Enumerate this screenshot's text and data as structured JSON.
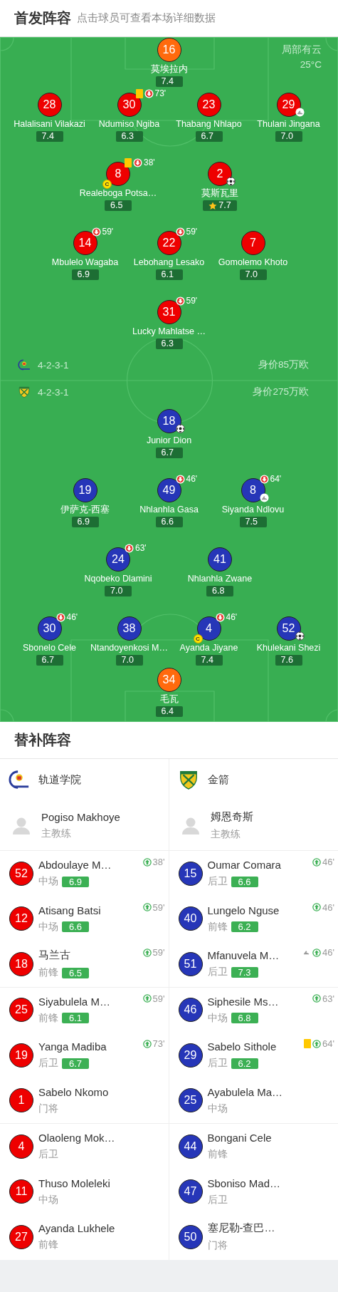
{
  "lineup_header": {
    "title": "首发阵容",
    "hint": "点击球员可查看本场详细数据"
  },
  "pitch": {
    "weather": {
      "condition": "局部有云",
      "temperature": "25°C"
    },
    "home_lines": [
      [
        {
          "number": "16",
          "name": "莫埃拉内",
          "rating": "7.4",
          "color": "#ff6a0d"
        }
      ],
      [
        {
          "number": "28",
          "name": "Halalisani Vilakazi",
          "rating": "7.4",
          "color": "#ee0000"
        },
        {
          "number": "30",
          "name": "Ndumiso Ngiba",
          "rating": "6.3",
          "color": "#ee0000",
          "events": [
            {
              "kind": "yellow"
            },
            {
              "kind": "off",
              "minute": "73'"
            }
          ]
        },
        {
          "number": "23",
          "name": "Thabang Nhlapo",
          "rating": "6.7",
          "color": "#ee0000"
        },
        {
          "number": "29",
          "name": "Thulani Jingana",
          "rating": "7.0",
          "color": "#ee0000",
          "events": [
            {
              "kind": "assist"
            }
          ]
        }
      ],
      [
        {
          "number": "8",
          "name": "Realeboga Potsa…",
          "rating": "6.5",
          "color": "#ee0000",
          "captain": "C",
          "events": [
            {
              "kind": "yellow"
            },
            {
              "kind": "off",
              "minute": "38'"
            }
          ]
        },
        {
          "number": "2",
          "name": "莫斯瓦里",
          "rating": "7.7",
          "color": "#ee0000",
          "events": [
            {
              "kind": "goal"
            },
            {
              "kind": "top_rated"
            }
          ]
        }
      ],
      [
        {
          "number": "14",
          "name": "Mbulelo Wagaba",
          "rating": "6.9",
          "color": "#ee0000",
          "events": [
            {
              "kind": "off",
              "minute": "59'"
            }
          ]
        },
        {
          "number": "22",
          "name": "Lebohang Lesako",
          "rating": "6.1",
          "color": "#ee0000",
          "events": [
            {
              "kind": "off",
              "minute": "59'"
            }
          ]
        },
        {
          "number": "7",
          "name": "Gomolemo Khoto",
          "rating": "7.0",
          "color": "#ee0000"
        }
      ],
      [
        {
          "number": "31",
          "name": "Lucky Mahlatse …",
          "rating": "6.3",
          "color": "#ee0000",
          "events": [
            {
              "kind": "off",
              "minute": "59'"
            }
          ]
        }
      ]
    ],
    "teams_info": [
      {
        "formation": "4-2-3-1",
        "value": "身价85万欧"
      },
      {
        "formation": "4-2-3-1",
        "value": "身价275万欧"
      }
    ],
    "away_lines": [
      [
        {
          "number": "18",
          "name": "Junior Dion",
          "rating": "6.7",
          "color": "#2636b8",
          "events": [
            {
              "kind": "goal"
            }
          ]
        }
      ],
      [
        {
          "number": "19",
          "name": "伊萨克-西塞",
          "rating": "6.9",
          "color": "#2636b8"
        },
        {
          "number": "49",
          "name": "Nhlanhla Gasa",
          "rating": "6.6",
          "color": "#2636b8",
          "events": [
            {
              "kind": "off",
              "minute": "46'"
            }
          ]
        },
        {
          "number": "8",
          "name": "Siyanda Ndlovu",
          "rating": "7.5",
          "color": "#2636b8",
          "events": [
            {
              "kind": "off",
              "minute": "64'"
            },
            {
              "kind": "assist"
            }
          ]
        }
      ],
      [
        {
          "number": "24",
          "name": "Nqobeko Dlamini",
          "rating": "7.0",
          "color": "#2636b8",
          "events": [
            {
              "kind": "off",
              "minute": "63'"
            }
          ]
        },
        {
          "number": "41",
          "name": "Nhlanhla Zwane",
          "rating": "6.8",
          "color": "#2636b8"
        }
      ],
      [
        {
          "number": "30",
          "name": "Sbonelo Cele",
          "rating": "6.7",
          "color": "#2636b8",
          "events": [
            {
              "kind": "off",
              "minute": "46'"
            }
          ]
        },
        {
          "number": "38",
          "name": "Ntandoyenkosi M…",
          "rating": "7.0",
          "color": "#2636b8"
        },
        {
          "number": "4",
          "name": "Ayanda Jiyane",
          "rating": "7.4",
          "color": "#2636b8",
          "captain": "C",
          "events": [
            {
              "kind": "off",
              "minute": "46'"
            }
          ]
        },
        {
          "number": "52",
          "name": "Khulekani Shezi",
          "rating": "7.6",
          "color": "#2636b8",
          "events": [
            {
              "kind": "goal"
            }
          ]
        }
      ],
      [
        {
          "number": "34",
          "name": "毛瓦",
          "rating": "6.4",
          "color": "#ff6a0d"
        }
      ]
    ]
  },
  "bench_header": {
    "title": "替补阵容"
  },
  "bench": [
    {
      "team": "轨道学院",
      "color": "#ee0000",
      "coach": {
        "name": "Pogiso Makhoye",
        "role": "主教练"
      },
      "groups": [
        [
          {
            "number": "52",
            "name": "Abdoulaye M…",
            "position": "中场",
            "rating": "6.9",
            "events": [
              {
                "kind": "on",
                "minute": "38'"
              }
            ]
          },
          {
            "number": "12",
            "name": "Atisang Batsi",
            "position": "中场",
            "rating": "6.6",
            "events": [
              {
                "kind": "on",
                "minute": "59'"
              }
            ]
          },
          {
            "number": "18",
            "name": "马兰古",
            "position": "前锋",
            "rating": "6.5",
            "events": [
              {
                "kind": "on",
                "minute": "59'"
              }
            ]
          }
        ],
        [
          {
            "number": "25",
            "name": "Siyabulela M…",
            "position": "前锋",
            "rating": "6.1",
            "events": [
              {
                "kind": "on",
                "minute": "59'"
              }
            ]
          },
          {
            "number": "19",
            "name": "Yanga Madiba",
            "position": "后卫",
            "rating": "6.7",
            "events": [
              {
                "kind": "on",
                "minute": "73'"
              }
            ]
          },
          {
            "number": "1",
            "name": "Sabelo Nkomo",
            "position": "门将"
          }
        ],
        [
          {
            "number": "4",
            "name": "Olaoleng Mok…",
            "position": "后卫"
          },
          {
            "number": "11",
            "name": "Thuso Moleleki",
            "position": "中场"
          },
          {
            "number": "27",
            "name": "Ayanda Lukhele",
            "position": "前锋"
          }
        ]
      ]
    },
    {
      "team": "金箭",
      "color": "#2636b8",
      "coach": {
        "name": "姆恩奇斯",
        "role": "主教练"
      },
      "groups": [
        [
          {
            "number": "15",
            "name": "Oumar Comara",
            "position": "后卫",
            "rating": "6.6",
            "events": [
              {
                "kind": "on",
                "minute": "46'"
              }
            ]
          },
          {
            "number": "40",
            "name": "Lungelo Nguse",
            "position": "前锋",
            "rating": "6.2",
            "events": [
              {
                "kind": "on",
                "minute": "46'"
              }
            ]
          },
          {
            "number": "51",
            "name": "Mfanuvela M…",
            "position": "后卫",
            "rating": "7.3",
            "events": [
              {
                "kind": "assist"
              },
              {
                "kind": "on",
                "minute": "46'"
              }
            ]
          }
        ],
        [
          {
            "number": "46",
            "name": "Siphesile Ms…",
            "position": "中场",
            "rating": "6.8",
            "events": [
              {
                "kind": "on",
                "minute": "63'"
              }
            ]
          },
          {
            "number": "29",
            "name": "Sabelo Sithole",
            "position": "后卫",
            "rating": "6.2",
            "events": [
              {
                "kind": "yellow"
              },
              {
                "kind": "on",
                "minute": "64'"
              }
            ]
          },
          {
            "number": "25",
            "name": "Ayabulela Ma…",
            "position": "中场"
          }
        ],
        [
          {
            "number": "44",
            "name": "Bongani Cele",
            "position": "前锋"
          },
          {
            "number": "47",
            "name": "Sboniso Mad…",
            "position": "后卫"
          },
          {
            "number": "50",
            "name": "塞尼勒-查巴…",
            "position": "门将"
          }
        ]
      ]
    }
  ]
}
